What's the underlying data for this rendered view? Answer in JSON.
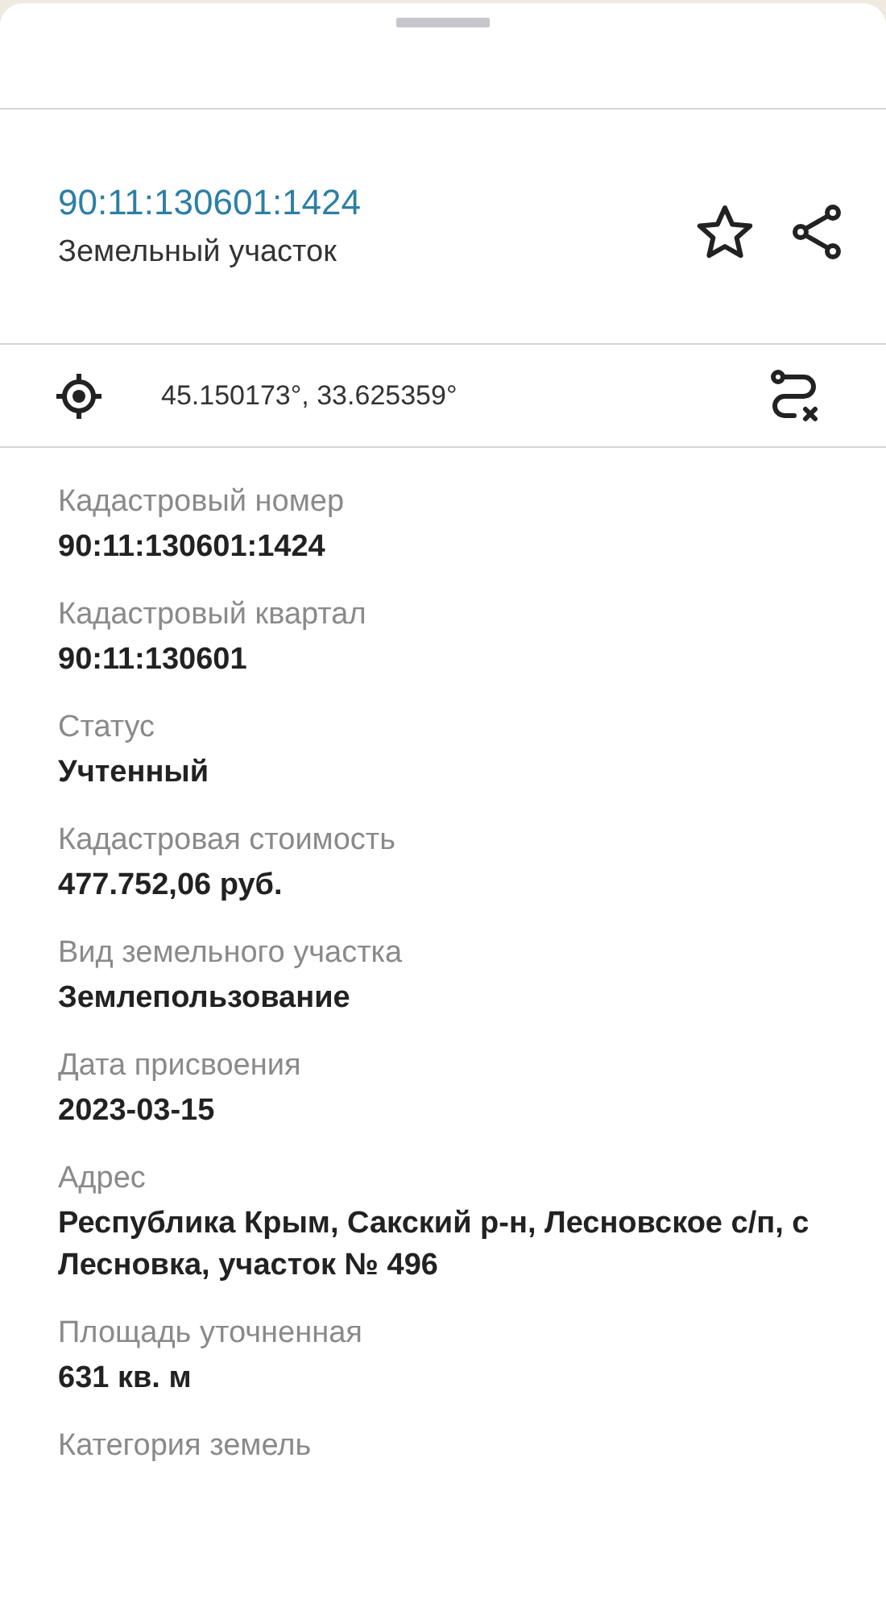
{
  "header": {
    "title": "90:11:130601:1424",
    "subtitle": "Земельный участок"
  },
  "location": {
    "coordinates": "45.150173°, 33.625359°"
  },
  "fields": [
    {
      "label": "Кадастровый номер",
      "value": "90:11:130601:1424"
    },
    {
      "label": "Кадастровый квартал",
      "value": "90:11:130601"
    },
    {
      "label": "Статус",
      "value": "Учтенный"
    },
    {
      "label": "Кадастровая стоимость",
      "value": "477.752,06 руб."
    },
    {
      "label": "Вид земельного участка",
      "value": "Землепользование"
    },
    {
      "label": "Дата присвоения",
      "value": "2023-03-15"
    },
    {
      "label": "Адрес",
      "value": "Республика Крым, Сакский р-н, Лесновское с/п, с Лесновка, участок № 496"
    },
    {
      "label": "Площадь уточненная",
      "value": "631 кв. м"
    },
    {
      "label": "Категория земель"
    }
  ]
}
